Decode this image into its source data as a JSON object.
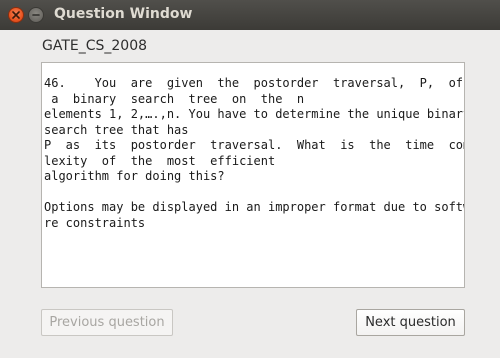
{
  "window": {
    "title": "Question Window"
  },
  "subject": {
    "label": "GATE_CS_2008"
  },
  "question": {
    "text": "46.    You  are  given  the  postorder  traversal,  P,  of\n a  binary  search  tree  on  the  n\nelements 1, 2,….,n. You have to determine the unique binary\nsearch tree that has\nP  as  its  postorder  traversal.  What  is  the  time  comp\nlexity  of  the  most  efficient\nalgorithm for doing this?\n\nOptions may be displayed in an improper format due to softwa\nre constraints"
  },
  "buttons": {
    "previous_label": "Previous question",
    "next_label": "Next question"
  },
  "colors": {
    "titlebar": "#3c3b37",
    "close_button": "#e95420",
    "window_bg": "#edeceb"
  },
  "icons": {
    "close": "close-icon",
    "minimize": "minimize-icon"
  }
}
